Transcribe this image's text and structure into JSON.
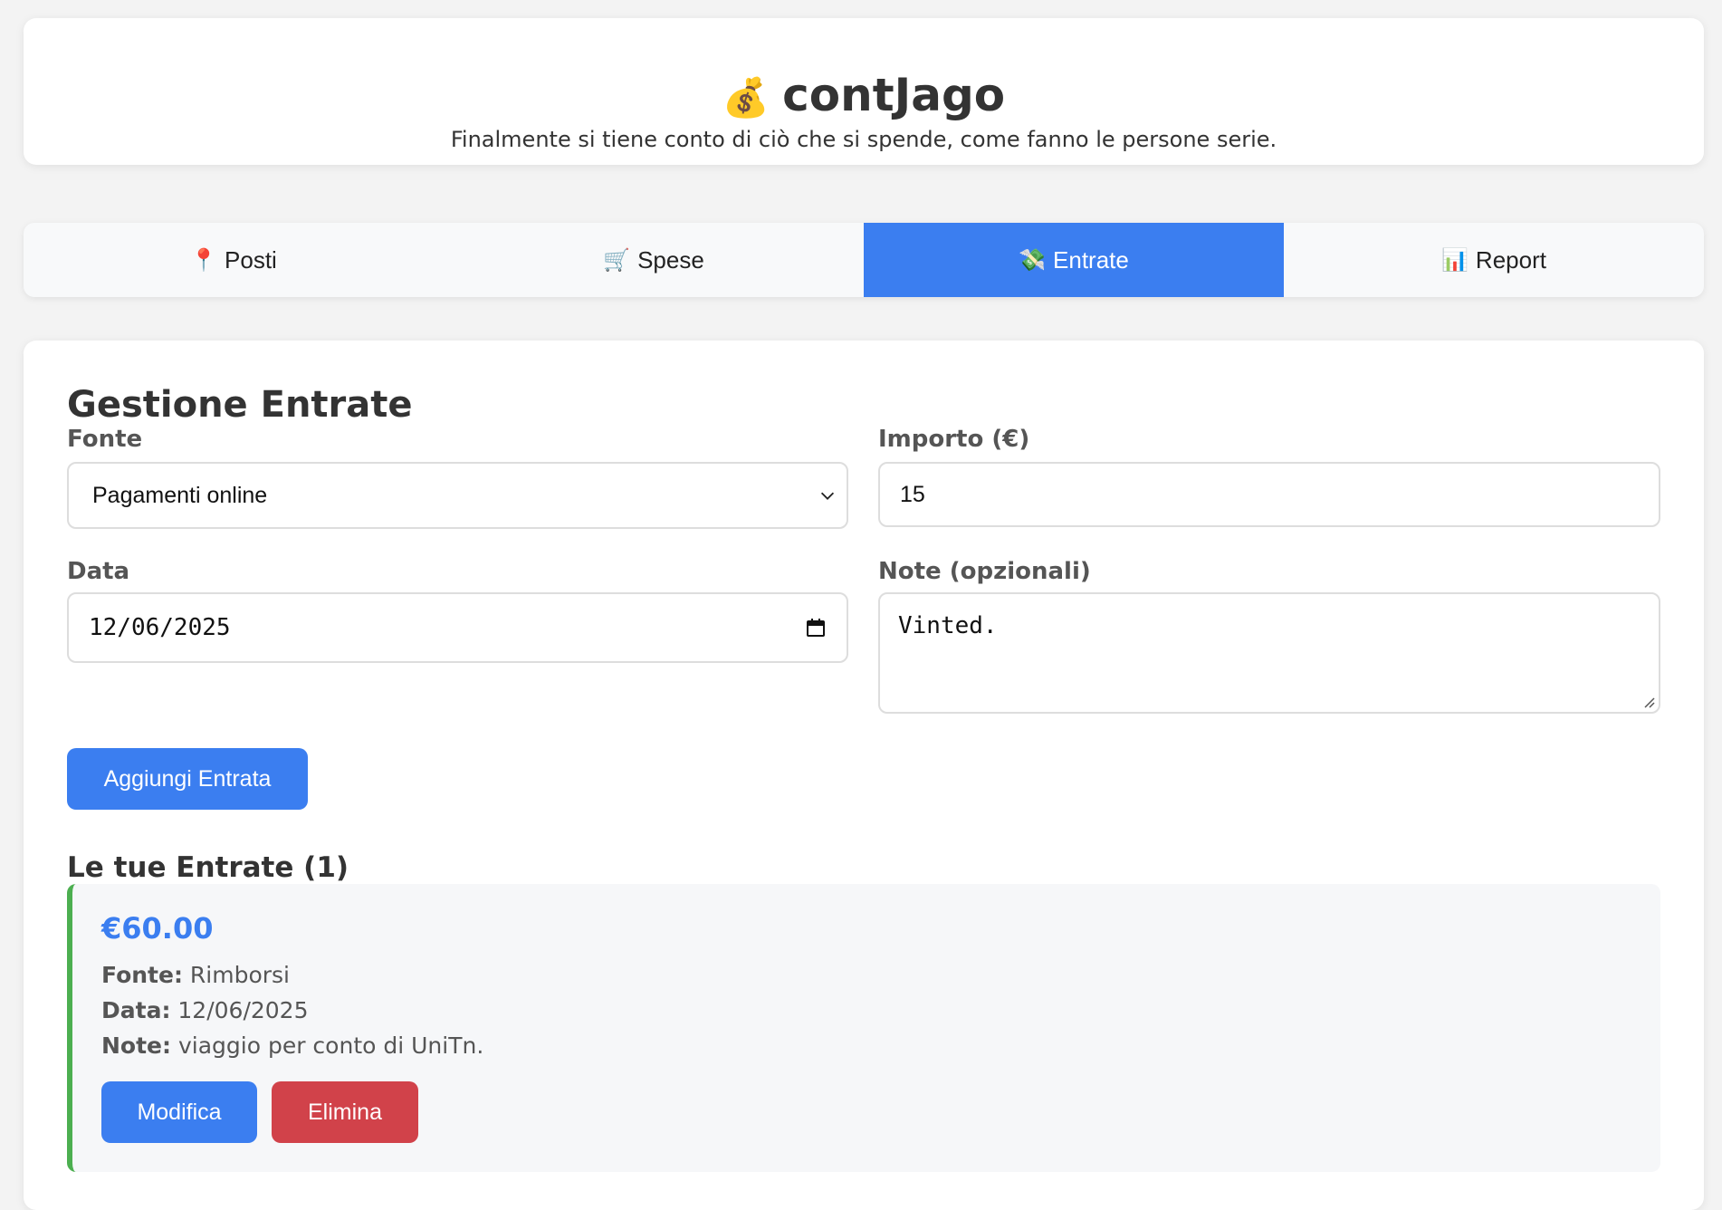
{
  "header": {
    "logo_icon": "money-bag-icon",
    "logo_glyph": "💰",
    "title": "contJago",
    "subtitle": "Finalmente si tiene conto di ciò che si spende, come fanno le persone serie."
  },
  "tabs": [
    {
      "icon": "📍",
      "icon_name": "pin-icon",
      "label": "Posti",
      "active": false
    },
    {
      "icon": "🛒",
      "icon_name": "cart-icon",
      "label": "Spese",
      "active": false
    },
    {
      "icon": "💸",
      "icon_name": "money-wings-icon",
      "label": "Entrate",
      "active": true
    },
    {
      "icon": "📊",
      "icon_name": "bar-chart-icon",
      "label": "Report",
      "active": false
    }
  ],
  "form": {
    "title": "Gestione Entrate",
    "fonte_label": "Fonte",
    "fonte_value": "Pagamenti online",
    "importo_label": "Importo (€)",
    "importo_value": "15",
    "data_label": "Data",
    "data_value": "12/06/2025",
    "note_label": "Note (opzionali)",
    "note_value": "Vinted.",
    "submit_label": "Aggiungi Entrata"
  },
  "list": {
    "title": "Le tue Entrate (1)",
    "entries": [
      {
        "amount": "€60.00",
        "fonte_label": "Fonte:",
        "fonte": "Rimborsi",
        "data_label": "Data:",
        "data": "12/06/2025",
        "note_label": "Note:",
        "note": "viaggio per conto di UniTn.",
        "edit_label": "Modifica",
        "delete_label": "Elimina"
      }
    ]
  },
  "colors": {
    "accent": "#3b7ef0",
    "danger": "#d1424a",
    "entry_border": "#4caf50",
    "background": "#f3f3f3"
  }
}
